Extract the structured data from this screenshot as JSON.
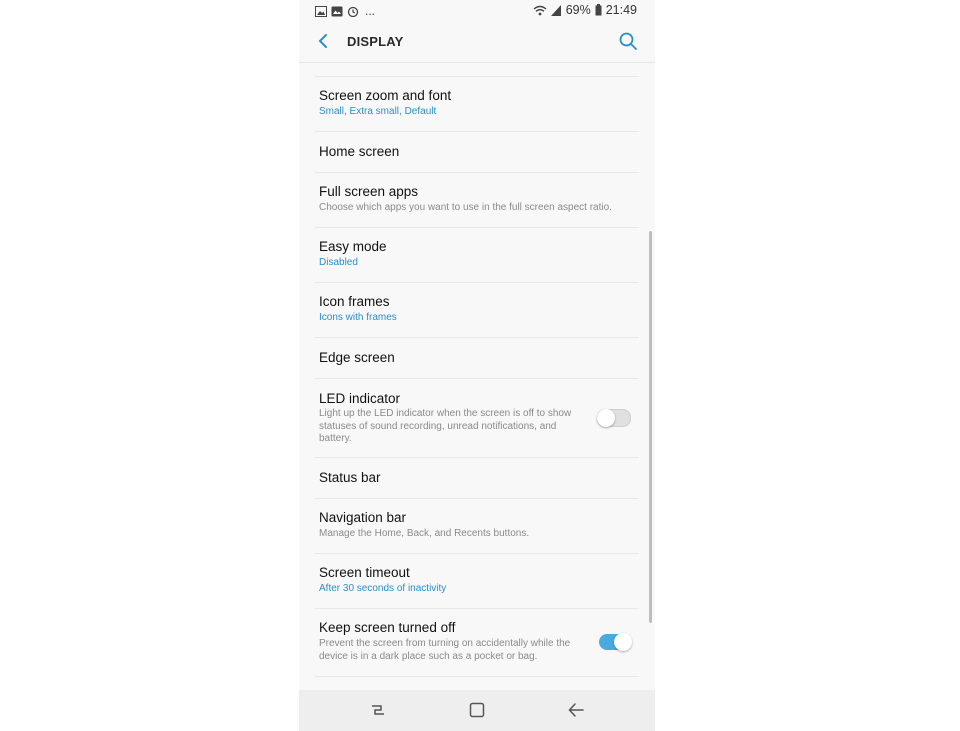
{
  "status_bar": {
    "notification_icons": [
      "gallery-icon",
      "photo-icon",
      "timer-icon"
    ],
    "more": "...",
    "battery_percent": "69%",
    "time": "21:49"
  },
  "app_bar": {
    "title": "DISPLAY",
    "back_icon": "chevron-left-icon",
    "search_icon": "search-icon"
  },
  "settings": {
    "screen_zoom": {
      "title": "Screen zoom and font",
      "subtitle": "Small, Extra small, Default"
    },
    "home_screen": {
      "title": "Home screen"
    },
    "full_screen_apps": {
      "title": "Full screen apps",
      "subtitle": "Choose which apps you want to use in the full screen aspect ratio."
    },
    "easy_mode": {
      "title": "Easy mode",
      "subtitle": "Disabled"
    },
    "icon_frames": {
      "title": "Icon frames",
      "subtitle": "Icons with frames"
    },
    "edge_screen": {
      "title": "Edge screen"
    },
    "led_indicator": {
      "title": "LED indicator",
      "subtitle": "Light up the LED indicator when the screen is off to show statuses of sound recording, unread notifications, and battery.",
      "enabled": false
    },
    "status_bar": {
      "title": "Status bar"
    },
    "navigation_bar": {
      "title": "Navigation bar",
      "subtitle": "Manage the Home, Back, and Recents buttons."
    },
    "screen_timeout": {
      "title": "Screen timeout",
      "subtitle": "After 30 seconds of inactivity"
    },
    "keep_screen_off": {
      "title": "Keep screen turned off",
      "subtitle": "Prevent the screen from turning on accidentally while the device is in a dark place such as a pocket or bag.",
      "enabled": true
    }
  },
  "nav_bar": {
    "buttons": [
      "recents-icon",
      "home-icon",
      "back-arrow-icon"
    ]
  },
  "colors": {
    "accent": "#2b8fc7",
    "toggle_on": "#4aa9e0",
    "background": "#f8f8f8"
  }
}
